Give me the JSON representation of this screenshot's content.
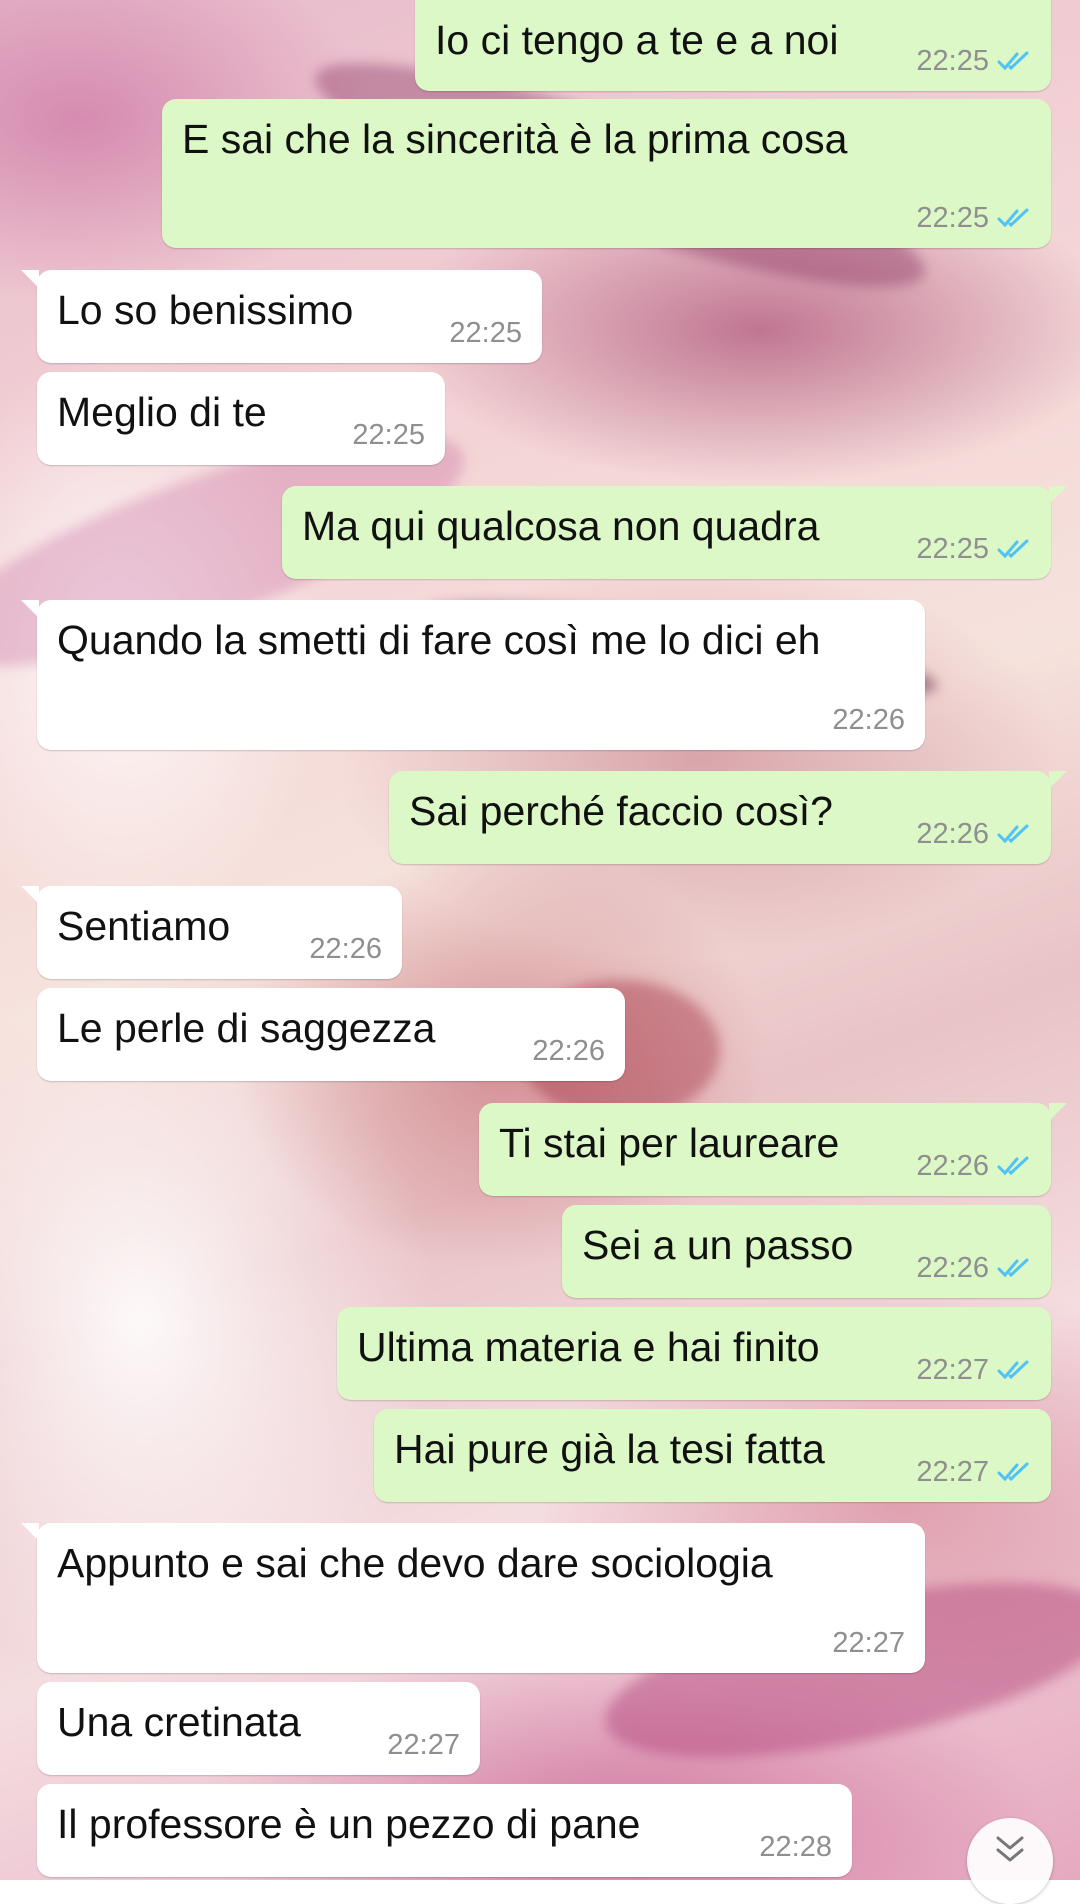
{
  "chat": {
    "messages": [
      {
        "text": "Io ci tengo a te e a noi",
        "time": "22:25",
        "direction": "outgoing",
        "status": "read"
      },
      {
        "text": "E sai che la sincerità è la prima cosa",
        "time": "22:25",
        "direction": "outgoing",
        "status": "read"
      },
      {
        "text": "Lo so benissimo",
        "time": "22:25",
        "direction": "incoming"
      },
      {
        "text": "Meglio di te",
        "time": "22:25",
        "direction": "incoming"
      },
      {
        "text": "Ma qui qualcosa non quadra",
        "time": "22:25",
        "direction": "outgoing",
        "status": "read"
      },
      {
        "text": "Quando la smetti di fare così me lo dici eh",
        "time": "22:26",
        "direction": "incoming"
      },
      {
        "text": "Sai perché faccio così?",
        "time": "22:26",
        "direction": "outgoing",
        "status": "read"
      },
      {
        "text": "Sentiamo",
        "time": "22:26",
        "direction": "incoming"
      },
      {
        "text": "Le perle di saggezza",
        "time": "22:26",
        "direction": "incoming"
      },
      {
        "text": "Ti stai per laureare",
        "time": "22:26",
        "direction": "outgoing",
        "status": "read"
      },
      {
        "text": "Sei a un passo",
        "time": "22:26",
        "direction": "outgoing",
        "status": "read"
      },
      {
        "text": "Ultima materia e hai finito",
        "time": "22:27",
        "direction": "outgoing",
        "status": "read"
      },
      {
        "text": "Hai pure già la tesi fatta",
        "time": "22:27",
        "direction": "outgoing",
        "status": "read"
      },
      {
        "text": "Appunto e sai che devo dare sociologia",
        "time": "22:27",
        "direction": "incoming"
      },
      {
        "text": "Una cretinata",
        "time": "22:27",
        "direction": "incoming"
      },
      {
        "text": "Il professore è un pezzo di pane",
        "time": "22:28",
        "direction": "incoming"
      }
    ]
  },
  "colors": {
    "outgoing_bubble": "#dcf8c6",
    "incoming_bubble": "#ffffff",
    "read_ticks": "#4fc3f7",
    "timestamp": "#8f8f8f"
  },
  "icons": {
    "read_receipt": "double-check-icon",
    "scroll_down": "chevron-double-down-icon"
  }
}
